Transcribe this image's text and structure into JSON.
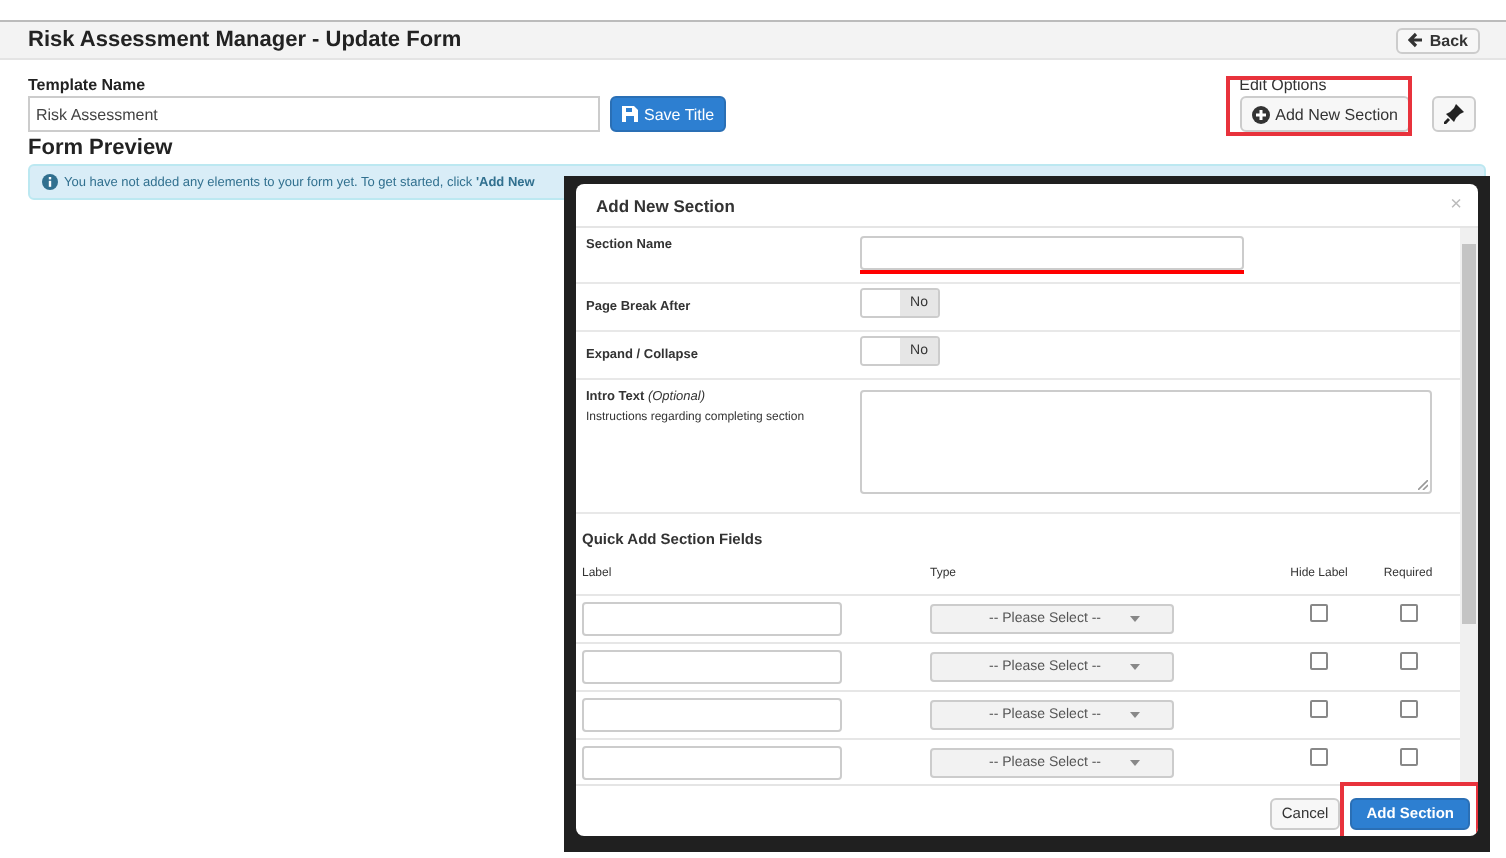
{
  "page": {
    "title": "Risk Assessment Manager - Update Form",
    "back_button": "Back"
  },
  "template_name": {
    "label": "Template Name",
    "value": "Risk Assessment",
    "save_button": "Save Title"
  },
  "edit_options": {
    "label": "Edit Options",
    "add_button": {
      "label": "Add New Section",
      "highlighted": true
    }
  },
  "form_preview": {
    "heading": "Form Preview",
    "alert": "You have not added any elements to your form yet. To get started, click **'Add New**"
  },
  "modal": {
    "title": "Add New Section",
    "close": "×",
    "fields": [
      {
        "kind": "text",
        "label": "Section Name",
        "highlighted": true
      },
      {
        "kind": "toggle",
        "label": "Page Break After",
        "on": false,
        "state_label": "No"
      },
      {
        "kind": "toggle",
        "label": "Expand / Collapse",
        "on": false,
        "state_label": "No"
      },
      {
        "kind": "textarea",
        "label": "Intro Text",
        "hint": "(Optional)",
        "description": "Instructions regarding completing section"
      }
    ],
    "quick_add": {
      "heading": "Quick Add Section Fields",
      "columns": [
        "Label",
        "Type",
        "Hide Label",
        "Required"
      ],
      "rows": [
        {
          "type_placeholder": "-- Please Select --",
          "hide_label": false,
          "required": false
        },
        {
          "type_placeholder": "-- Please Select --",
          "hide_label": false,
          "required": false
        },
        {
          "type_placeholder": "-- Please Select --",
          "hide_label": false,
          "required": false
        },
        {
          "type_placeholder": "-- Please Select --",
          "hide_label": false,
          "required": false
        }
      ]
    },
    "buttons": [
      {
        "label": "Cancel",
        "kind": "default",
        "highlighted": false
      },
      {
        "label": "Add Section",
        "kind": "primary",
        "highlighted": true
      }
    ]
  }
}
